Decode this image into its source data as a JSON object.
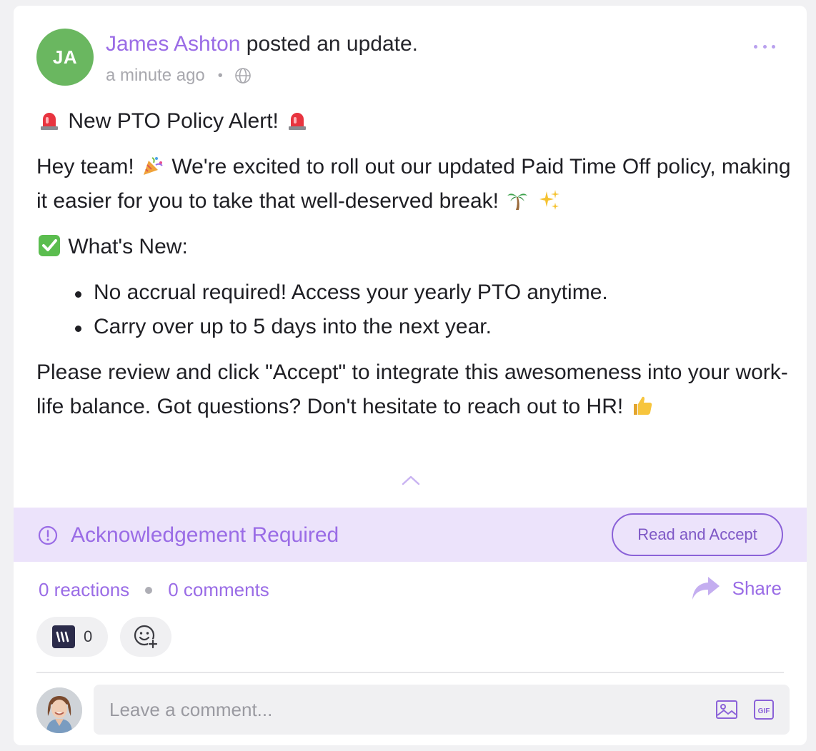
{
  "post": {
    "author_initials": "JA",
    "author_name": "James Ashton",
    "action_text": "posted an update.",
    "timestamp": "a minute ago",
    "visibility_icon": "globe-icon",
    "title_text": "New PTO Policy Alert!",
    "paragraph1_part1": "Hey team!",
    "paragraph1_part2": "We're excited to roll out our updated Paid Time Off policy, making it easier for you to take that well-deserved break!",
    "whats_new_label": "What's New:",
    "bullets": [
      "No accrual required! Access your yearly PTO anytime.",
      "Carry over up to 5 days into the next year."
    ],
    "closing_text": "Please review and click \"Accept\" to integrate this awesomeness into your work-life balance. Got questions? Don't hesitate to reach out to HR!"
  },
  "acknowledgement": {
    "label": "Acknowledgement Required",
    "button_label": "Read and Accept"
  },
  "stats": {
    "reactions_text": "0 reactions",
    "comments_text": "0 comments",
    "share_label": "Share"
  },
  "reactions": {
    "count": "0"
  },
  "comment": {
    "placeholder": "Leave a comment...",
    "gif_label": "GIF"
  },
  "colors": {
    "accent": "#9a6ce6",
    "avatar_bg": "#6ab760",
    "ack_bg": "#ece3fb"
  }
}
